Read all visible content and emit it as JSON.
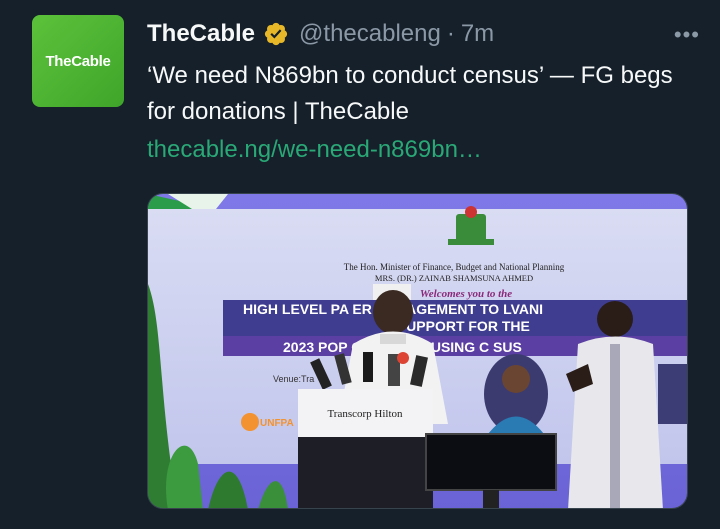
{
  "tweet": {
    "avatar_text": "TheCable",
    "name": "TheCable",
    "handle": "@thecableng",
    "separator": "·",
    "time": "7m",
    "more": "•••",
    "text": "‘We need N869bn to conduct census’ — FG begs for donations | TheCable",
    "link": "thecable.ng/we-need-n869bn…"
  },
  "image": {
    "sub_line1": "The Hon. Minister of Finance, Budget and National Planning",
    "sub_line2": "MRS. (DR.) ZAINAB SHAMSUNA AHMED",
    "welcome": "Welcomes you to the",
    "banner1": "HIGH LEVEL PA   ER ENGAGEMENT TO   LVANI",
    "banner2": "UPPORT FOR THE",
    "banner3": "2023 POP     ON AND HOUSING C   SUS",
    "venue": "Venue:Tra",
    "podium": "Transcorp Hilton",
    "unfpa": "UNFPA"
  },
  "colors": {
    "background": "#15202b",
    "muted": "#8b98a5",
    "link": "#2aa876",
    "verified": "#e8b829"
  }
}
